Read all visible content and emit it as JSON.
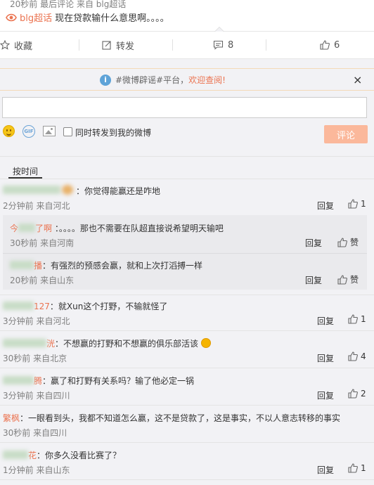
{
  "post": {
    "meta_time": "20秒前",
    "meta_last_comment": "最后评论",
    "meta_source_prefix": "来自",
    "meta_source": "blg超话",
    "topic": "blg超话",
    "text": "现在贷款输什么意思啊。。。。"
  },
  "actions": {
    "favorite": "收藏",
    "repost": "转发",
    "comment_count": "8",
    "like_count": "6"
  },
  "notice": {
    "prefix": "#微博辟谣#平台，",
    "link": "欢迎查阅!"
  },
  "composer": {
    "gif_label": "GIF",
    "also_repost": "同时转发到我的微博",
    "submit": "评论"
  },
  "sort_label": "按时间",
  "reply_label": "回复",
  "like_label": "赞",
  "comments": [
    {
      "text": "：你觉得能赢还是咋地",
      "meta": "2分钟前 来自河北",
      "likes": "1"
    },
    {
      "name": "今",
      "name2": "了啊",
      "text": "：。。。。那也不需要在队超直接说希望明天输吧",
      "meta": "30秒前 来自河南"
    },
    {
      "name": "播",
      "text": "：有强烈的预感会赢，就和上次打滔搏一样",
      "meta": "20秒前 来自山东"
    },
    {
      "name": "127",
      "text": "：就Xun这个打野，不输就怪了",
      "meta": "3分钟前 来自河北",
      "likes": "1"
    },
    {
      "name": "洸",
      "text": "：不想赢的打野和不想赢的俱乐部活该",
      "meta": "30秒前 来自北京",
      "likes": "4"
    },
    {
      "name": "腾",
      "text": "：赢了和打野有关系吗？输了他必定一锅",
      "meta": "3分钟前 来自四川",
      "likes": "2"
    },
    {
      "name": "繁枫",
      "text": "：一眼看到头，我都不知道怎么赢，这不是贷款了，这是事实，不以人意志转移的事实",
      "meta": "30秒前 来自四川"
    },
    {
      "name": "花",
      "text": "：你多久没看比赛了？",
      "meta": "1分钟前 来自山东",
      "likes": "1"
    }
  ],
  "colors": {
    "accent": "#eb7350",
    "panel_bg": "#f2f2f5",
    "submit_bg": "#fbb89b"
  }
}
